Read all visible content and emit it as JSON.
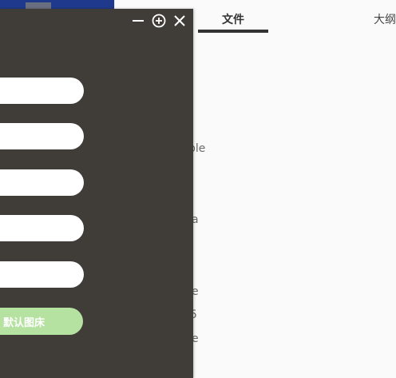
{
  "tabs": {
    "files": "文件",
    "outline": "大纲"
  },
  "file_list": {
    "snippets": [
      "ple",
      "a",
      "e",
      "5",
      "e"
    ]
  },
  "dialog": {
    "fields": [
      {
        "value": "",
        "placeholder": ""
      },
      {
        "value": "",
        "placeholder": ""
      },
      {
        "value": "",
        "placeholder": ""
      },
      {
        "value": "",
        "placeholder": ""
      },
      {
        "value": "",
        "placeholder": ""
      }
    ],
    "set_default_label": "默认图床"
  },
  "colors": {
    "dialog_bg": "#403d39",
    "accent_green": "#b6e2a1",
    "tab_underline": "#333333",
    "app_bg": "#fafafa"
  },
  "icons": {
    "minimize": "minimize-icon",
    "maximize": "maximize-icon",
    "close": "close-icon"
  }
}
